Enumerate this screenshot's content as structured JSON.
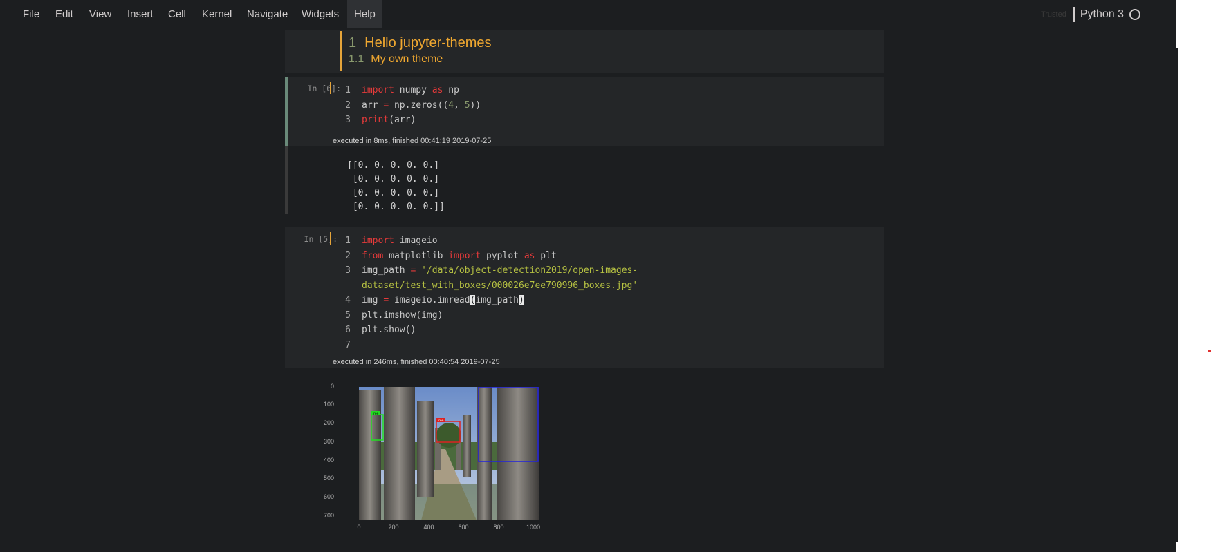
{
  "menubar": {
    "items": [
      "File",
      "Edit",
      "View",
      "Insert",
      "Cell",
      "Kernel",
      "Navigate",
      "Widgets",
      "Help"
    ],
    "active": "Help"
  },
  "kernel": {
    "trusted": "Trusted",
    "name": "Python 3"
  },
  "markdown_cell": {
    "h1_num": "1",
    "h1_text": "Hello jupyter-themes",
    "h2_num": "1.1",
    "h2_text": "My own theme"
  },
  "cell1": {
    "prompt": "In [6]:",
    "exec_info": "executed in 8ms, finished 00:41:19 2019-07-25",
    "output": [
      "[[0. 0. 0. 0. 0.]",
      " [0. 0. 0. 0. 0.]",
      " [0. 0. 0. 0. 0.]",
      " [0. 0. 0. 0. 0.]]"
    ]
  },
  "cell2": {
    "prompt": "In [5]:",
    "exec_info": "executed in 246ms, finished 00:40:54 2019-07-25"
  },
  "plot": {
    "y_ticks": [
      "0",
      "100",
      "200",
      "300",
      "400",
      "500",
      "600",
      "700"
    ],
    "x_ticks": [
      "0",
      "200",
      "400",
      "600",
      "800",
      "1000"
    ],
    "box_labels": [
      "Tree",
      "Tree"
    ]
  },
  "colors": {
    "background": "#1c1e20",
    "cell_bg": "#242628",
    "heading": "#f0a830",
    "keyword": "#e43a3a",
    "string": "#b5c042",
    "number": "#8a9a6e"
  }
}
